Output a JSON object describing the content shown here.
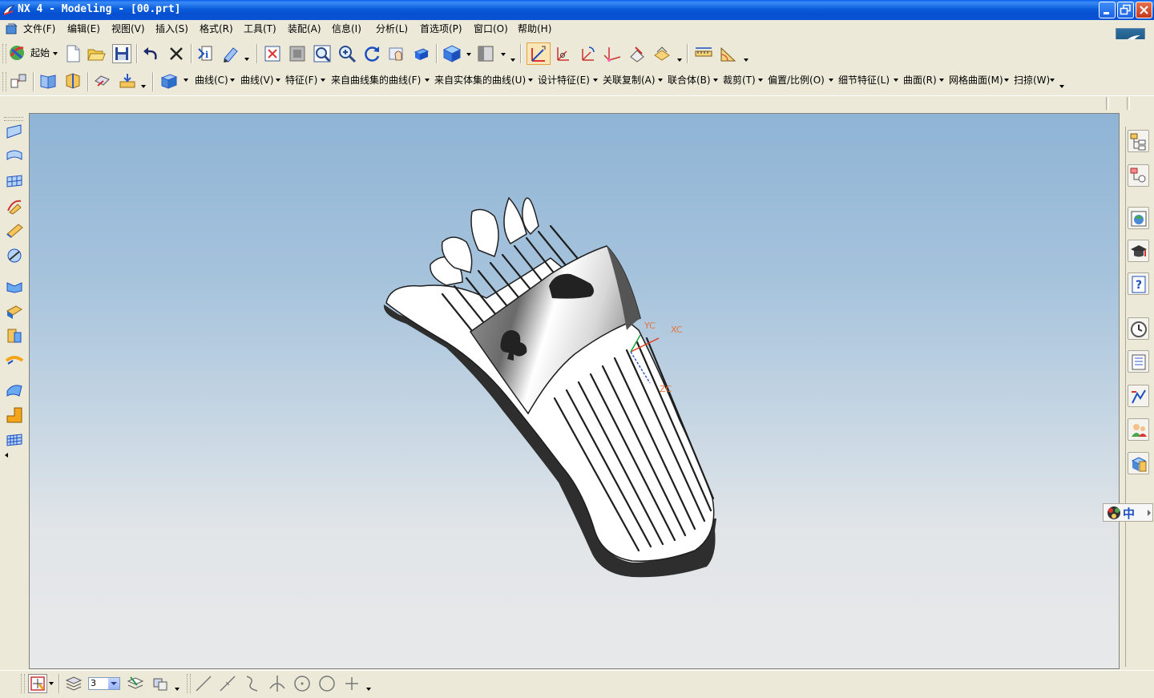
{
  "window": {
    "title": "NX 4 - Modeling - [00.prt]",
    "controls": [
      "minimize",
      "restore",
      "close"
    ]
  },
  "menubar": {
    "items": [
      "文件(F)",
      "编辑(E)",
      "视图(V)",
      "插入(S)",
      "格式(R)",
      "工具(T)",
      "装配(A)",
      "信息(I)",
      "分析(L)",
      "首选项(P)",
      "窗口(O)",
      "帮助(H)"
    ]
  },
  "toolbar1": {
    "start_label": "起始",
    "icons": [
      "start-icon",
      "new-icon",
      "open-icon",
      "save-icon",
      "undo-icon",
      "delete-icon",
      "information-icon",
      "edit-object-icon",
      "fit-icon",
      "zoom-window-icon",
      "zoom-icon",
      "zoom-in-out-icon",
      "rotate-icon",
      "pan-icon",
      "orient-view-icon",
      "shaded-view-icon",
      "display-mode-icon",
      "wcs-dynamic-icon",
      "wcs-origin-icon",
      "wcs-rotate-icon",
      "wcs-orient-icon",
      "wcs-save-icon",
      "wcs-display-icon",
      "measure-distance-icon",
      "measure-angle-icon"
    ]
  },
  "toolbar2": {
    "menus": [
      "曲线(C)",
      "曲线(V)",
      "特征(F)",
      "来自曲线集的曲线(F)",
      "来自实体集的曲线(U)",
      "设计特征(E)",
      "关联复制(A)",
      "联合体(B)",
      "裁剪(T)",
      "偏置/比例(O)",
      "细节特征(L)",
      "曲面(R)",
      "网格曲面(M)",
      "扫掠(W)"
    ]
  },
  "viewport": {
    "wcs_labels": {
      "x": "XC",
      "y": "YC",
      "z": "ZC"
    },
    "model": "shoe-sole-with-band"
  },
  "left_toolbar": {
    "icons": [
      "surface-icon",
      "through-curves-icon",
      "through-mesh-icon",
      "swept-icon",
      "ruled-icon",
      "section-surface-icon",
      "bounded-plane-icon",
      "extension-icon",
      "offset-surface-icon",
      "bridge-icon",
      "law-extension-icon",
      "trimmed-sheet-icon",
      "sew-icon"
    ]
  },
  "resource_bar": {
    "icons": [
      "assembly-navigator-icon",
      "part-navigator-icon",
      "web-browser-icon",
      "training-icon",
      "help-icon",
      "history-icon",
      "system-materials-icon",
      "roles-icon",
      "palette-icon",
      "system-scenes-icon"
    ]
  },
  "ime": {
    "label": "中"
  },
  "bottom_toolbar": {
    "layer_value": "3",
    "icons": [
      "snap-point-icon",
      "layer-settings-icon",
      "work-layer-icon",
      "move-to-layer-icon",
      "line-icon",
      "line-point-icon",
      "arc-icon",
      "normal-line-icon",
      "circle-icon",
      "circle-center-icon",
      "point-icon"
    ]
  },
  "colors": {
    "titlebar": "#0a5ddb",
    "chrome": "#ece9d8",
    "viewport_top": "#8fb4d5",
    "viewport_bottom": "#e8e9ea",
    "wcs_x": "#e83a1d",
    "wcs_y": "#1aa33a",
    "wcs_z": "#3456c8"
  }
}
